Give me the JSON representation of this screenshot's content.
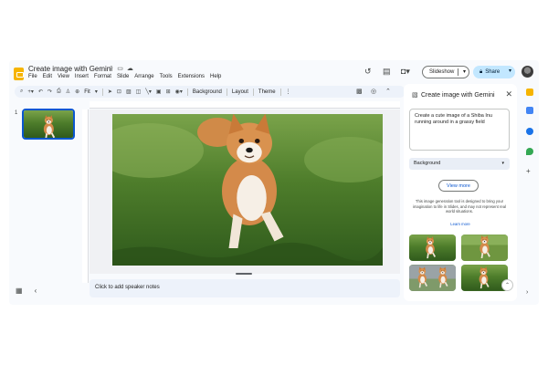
{
  "doc": {
    "title": "Create image with Gemini"
  },
  "menu": [
    "File",
    "Edit",
    "View",
    "Insert",
    "Format",
    "Slide",
    "Arrange",
    "Tools",
    "Extensions",
    "Help"
  ],
  "toolbar": {
    "zoom": "Fit",
    "background": "Background",
    "layout": "Layout",
    "theme": "Theme"
  },
  "header": {
    "slideshow": "Slideshow",
    "share": "Share"
  },
  "filmstrip": {
    "slide_number": "1"
  },
  "notes": {
    "placeholder": "Click to add speaker notes"
  },
  "panel": {
    "title": "Create image with Gemini",
    "prompt": "Create a cute image of a Shiba Inu running around in a grassy field",
    "style": "Background",
    "view_more": "View more",
    "disclaimer": "This image generation tool is designed to bring your imagination to life in Slides, and may not represent real world situations.",
    "learn_more": "Learn more"
  },
  "colors": {
    "accent": "#0b57d0",
    "share_bg": "#c2e7ff",
    "logo": "#f6b400",
    "toolbar_bg": "#edf2fa"
  }
}
